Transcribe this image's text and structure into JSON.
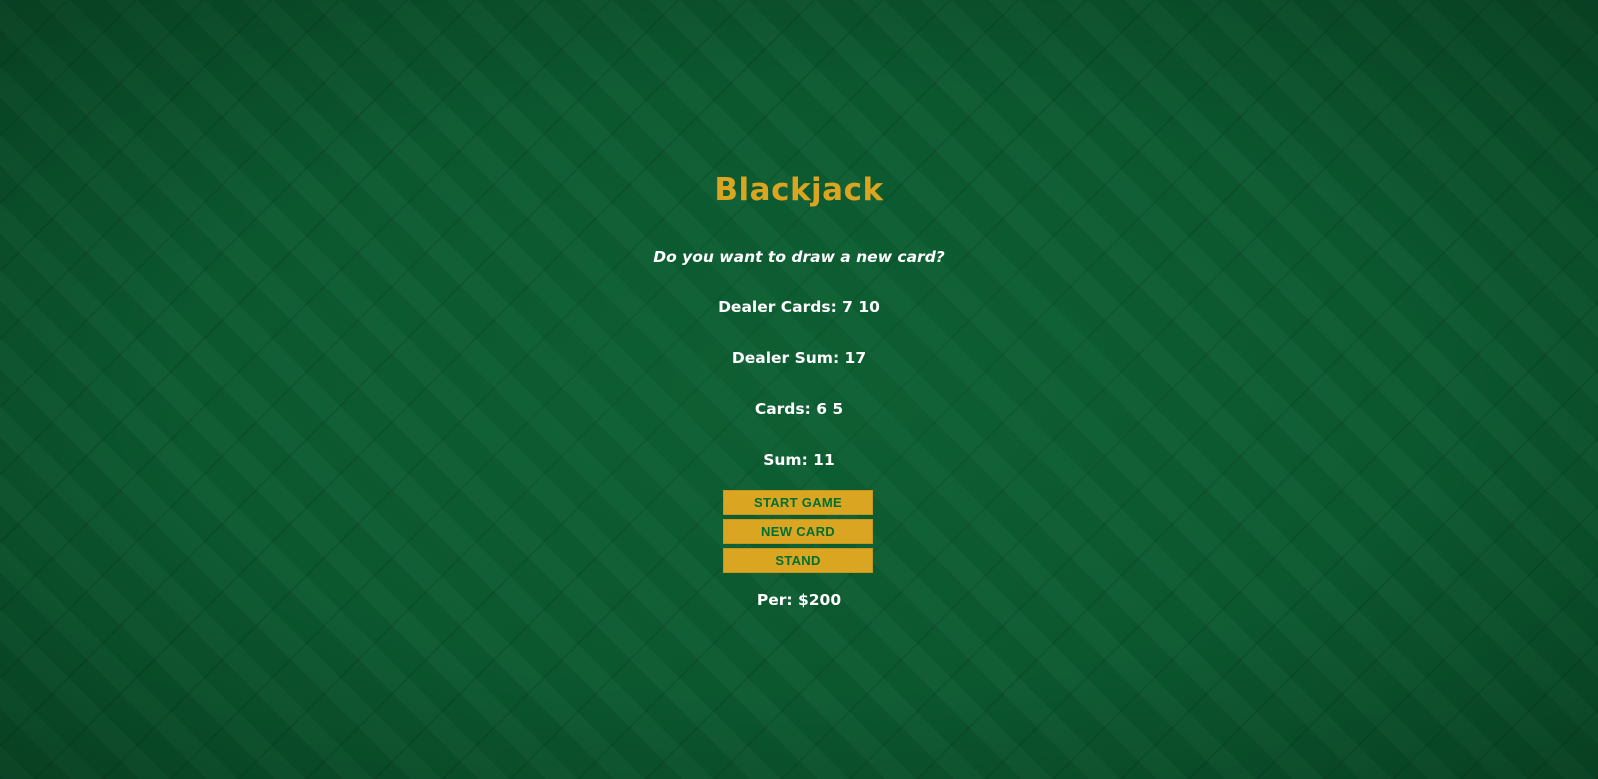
{
  "game": {
    "title": "Blackjack",
    "message": "Do you want to draw a new card?",
    "dealer_cards": "Dealer Cards: 7 10",
    "dealer_sum": "Dealer Sum: 17",
    "cards": "Cards: 6 5",
    "sum": "Sum: 11",
    "player": "Per: $200"
  },
  "buttons": {
    "start": "START GAME",
    "new_card": "NEW CARD",
    "stand": "STAND"
  },
  "colors": {
    "background": "#0b5a30",
    "accent": "#daa520",
    "button_text": "#016f32",
    "text": "#ffffff"
  }
}
